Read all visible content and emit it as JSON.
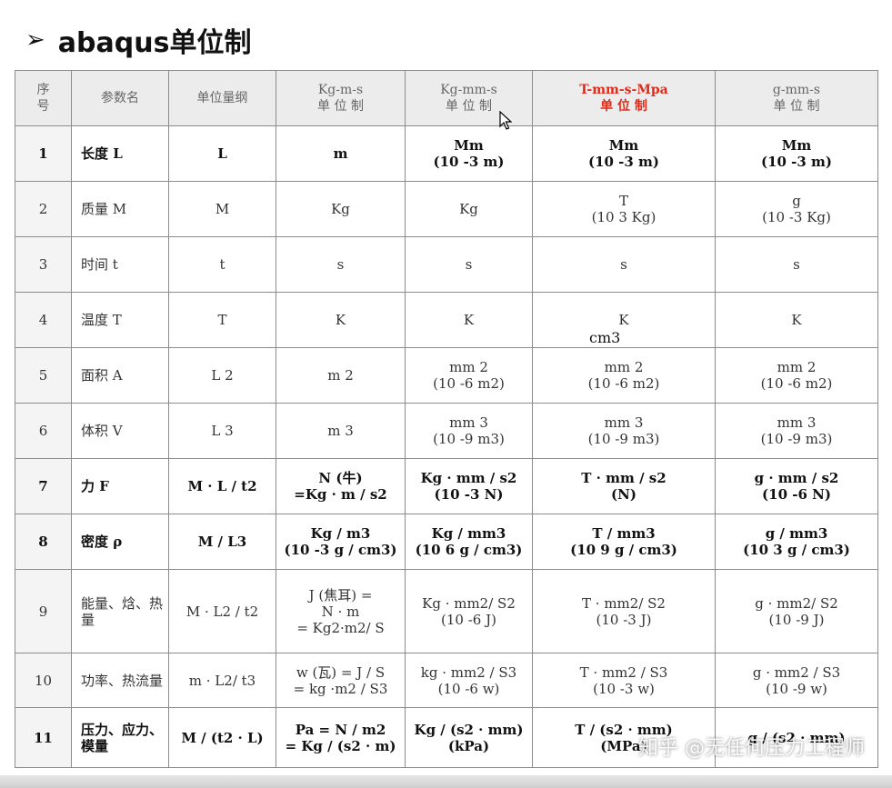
{
  "title": {
    "bullet": "➢",
    "text": "abaqus单位制"
  },
  "table": {
    "headers": [
      {
        "line1": "序",
        "line2": "号"
      },
      {
        "line1": "参数名",
        "line2": ""
      },
      {
        "line1": "单位量纲",
        "line2": ""
      },
      {
        "line1": "Kg-m-s",
        "line2": "单 位 制"
      },
      {
        "line1": "Kg-mm-s",
        "line2": "单 位 制"
      },
      {
        "line1": "T-mm-s-Mpa",
        "line2": "单 位 制"
      },
      {
        "line1": "g-mm-s",
        "line2": "单 位 制"
      }
    ],
    "rows": [
      {
        "idx": "1",
        "name": "长度 L",
        "dim": "L",
        "c1": "m",
        "c2a": "Mm",
        "c2b": "(10 -3 m)",
        "c3a": "Mm",
        "c3b": "(10 -3 m)",
        "c4a": "Mm",
        "c4b": "(10 -3 m)"
      },
      {
        "idx": "2",
        "name": "质量 M",
        "dim": "M",
        "c1": "Kg",
        "c2a": "Kg",
        "c2b": "",
        "c3a": "T",
        "c3b": "(10 3 Kg)",
        "c4a": "g",
        "c4b": "(10 -3 Kg)"
      },
      {
        "idx": "3",
        "name": "时间 t",
        "dim": "t",
        "c1": "s",
        "c2a": "s",
        "c2b": "",
        "c3a": "s",
        "c3b": "",
        "c4a": "s",
        "c4b": ""
      },
      {
        "idx": "4",
        "name": "温度 T",
        "dim": "T",
        "c1": "K",
        "c2a": "K",
        "c2b": "",
        "c3a": "K",
        "c3b": "",
        "c4a": "K",
        "c4b": ""
      },
      {
        "idx": "5",
        "name": "面积 A",
        "dim": "L 2",
        "c1": "m 2",
        "c2a": "mm 2",
        "c2b": "(10 -6 m2)",
        "c3a": "mm 2",
        "c3b": "(10 -6 m2)",
        "c4a": "mm 2",
        "c4b": "(10 -6 m2)"
      },
      {
        "idx": "6",
        "name": "体积 V",
        "dim": "L 3",
        "c1": "m 3",
        "c2a": "mm 3",
        "c2b": "(10 -9 m3)",
        "c3a": "mm 3",
        "c3b": "(10 -9 m3)",
        "c4a": "mm 3",
        "c4b": "(10 -9 m3)"
      },
      {
        "idx": "7",
        "name": "力 F",
        "dim": "M · L / t2",
        "c1a": "N (牛)",
        "c1b": "=Kg · m / s2",
        "c2a": "Kg · mm / s2",
        "c2b": "(10 -3 N)",
        "c3a": "T · mm / s2",
        "c3b": "(N)",
        "c4a": "g · mm / s2",
        "c4b": "(10 -6 N)"
      },
      {
        "idx": "8",
        "name": "密度 ρ",
        "dim": "M / L3",
        "c1a": "Kg / m3",
        "c1b": "(10 -3 g / cm3)",
        "c2a": "Kg / mm3",
        "c2b": "(10 6 g / cm3)",
        "c3a": "T / mm3",
        "c3b": "(10 9 g / cm3)",
        "c4a": "g / mm3",
        "c4b": "(10 3 g / cm3)"
      },
      {
        "idx": "9",
        "name": "能量、焓、热量",
        "dim": "M · L2 / t2",
        "c1a": "J (焦耳) =",
        "c1b": "N · m",
        "c1c": "= Kg2·m2/ S",
        "c2a": "Kg · mm2/ S2",
        "c2b": "(10 -6 J)",
        "c3a": "T · mm2/ S2",
        "c3b": "(10 -3 J)",
        "c4a": "g · mm2/ S2",
        "c4b": "(10 -9 J)"
      },
      {
        "idx": "10",
        "name": "功率、热流量",
        "dim": "m · L2/ t3",
        "c1a": "w (瓦) = J / S",
        "c1b": "= kg ·m2 / S3",
        "c2a": "kg · mm2 / S3",
        "c2b": "(10 -6 w)",
        "c3a": "T · mm2 / S3",
        "c3b": "(10 -3 w)",
        "c4a": "g · mm2 / S3",
        "c4b": "(10 -9 w)"
      },
      {
        "idx": "11",
        "name": "压力、应力、模量",
        "dim": "M / (t2 · L)",
        "c1a": "Pa = N / m2",
        "c1b": "= Kg / (s2 · m)",
        "c2a": "Kg / (s2 · mm)",
        "c2b": "(kPa)",
        "c3a": "T / (s2 · mm)",
        "c3b": "(MPa)",
        "c4a": "g / (s2 · mm)",
        "c4b": ""
      }
    ]
  },
  "stray_label": "cm3",
  "watermark": "知乎 @无任何压力工程师"
}
